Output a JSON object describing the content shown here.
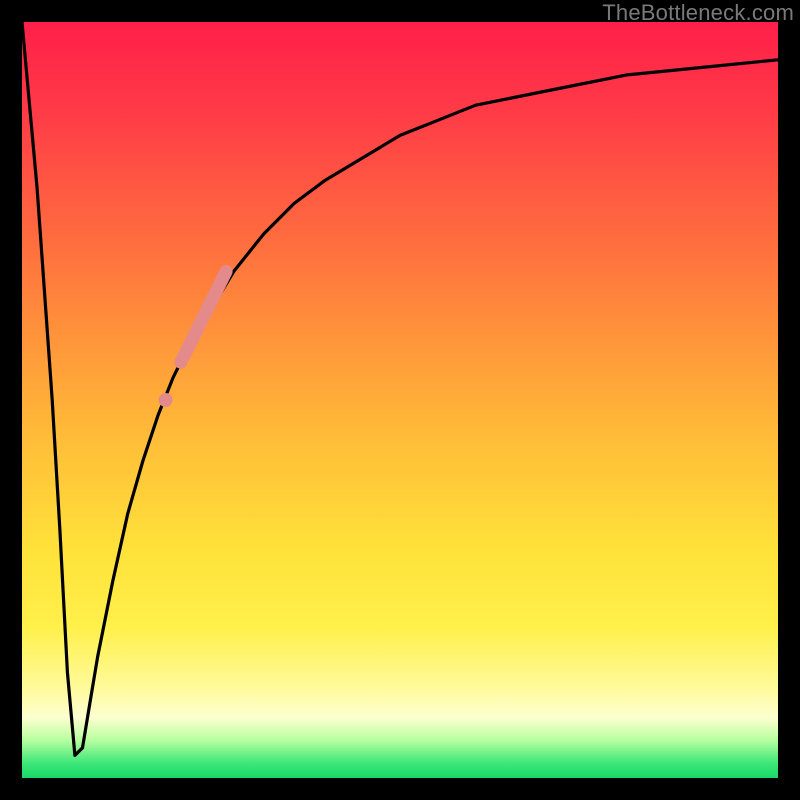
{
  "watermark": "TheBottleneck.com",
  "colors": {
    "background": "#000000",
    "curve": "#000000",
    "marker": "#e58a8a"
  },
  "chart_data": {
    "type": "line",
    "title": "",
    "xlabel": "",
    "ylabel": "",
    "xlim": [
      0,
      100
    ],
    "ylim": [
      0,
      100
    ],
    "x": [
      0,
      2,
      4,
      5,
      6,
      7,
      8,
      9,
      10,
      12,
      14,
      16,
      18,
      20,
      22,
      25,
      28,
      32,
      36,
      40,
      45,
      50,
      55,
      60,
      70,
      80,
      90,
      100
    ],
    "values": [
      100,
      78,
      50,
      33,
      14,
      3,
      4,
      10,
      16,
      26,
      35,
      42,
      48,
      53,
      57,
      62,
      67,
      72,
      76,
      79,
      82,
      85,
      87,
      89,
      91,
      93,
      94,
      95
    ],
    "markers": {
      "comment": "highlighted pink segment on the rising part of the curve",
      "x": [
        19,
        20,
        21,
        22,
        23,
        24,
        25,
        26,
        27
      ],
      "values": [
        50,
        53,
        55,
        57,
        59,
        61,
        63,
        65,
        67
      ]
    }
  }
}
